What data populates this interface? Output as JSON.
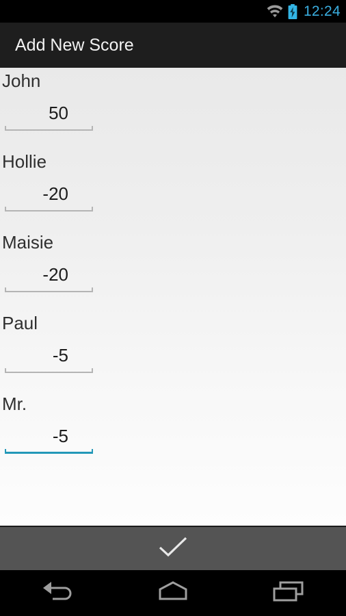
{
  "status_bar": {
    "time": "12:24",
    "wifi_icon": "wifi-icon",
    "battery_icon": "battery-charging-icon",
    "time_color": "#3aaee0",
    "wifi_color": "#9a9a9a",
    "battery_color": "#33b5e5"
  },
  "action_bar": {
    "title": "Add New Score",
    "background": "#1e1e1e",
    "title_color": "#f2f2f2"
  },
  "form": {
    "fields": [
      {
        "label": "John",
        "value": "50",
        "focused": false
      },
      {
        "label": "Hollie",
        "value": "-20",
        "focused": false
      },
      {
        "label": "Maisie",
        "value": "-20",
        "focused": false
      },
      {
        "label": "Paul",
        "value": "-5",
        "focused": false
      },
      {
        "label": "Mr.",
        "value": "-5",
        "focused": true
      }
    ],
    "underline_color": "#b4b4b4",
    "focused_underline_color": "#2398b8"
  },
  "confirm_bar": {
    "icon": "check-icon",
    "background": "#545454",
    "icon_color": "#e8e8e8"
  },
  "nav_bar": {
    "buttons": [
      {
        "name": "back-icon"
      },
      {
        "name": "home-icon"
      },
      {
        "name": "recents-icon"
      }
    ],
    "icon_color": "#9e9e9e",
    "background": "#000000"
  }
}
